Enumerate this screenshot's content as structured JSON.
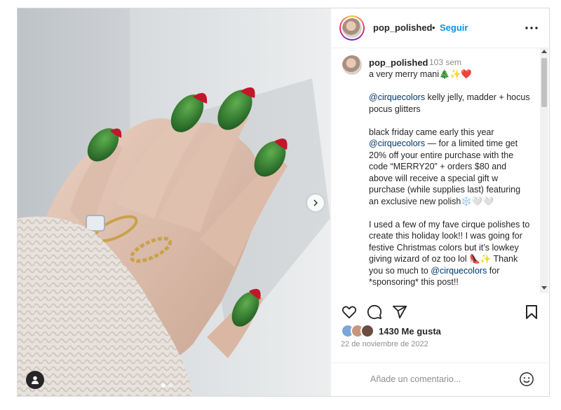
{
  "header": {
    "username": "pop_polished",
    "separator": "•",
    "follow_label": "Seguir"
  },
  "caption": {
    "username": "pop_polished",
    "time": "103 sem",
    "line1": "a very merry mani🎄✨❤️",
    "mention1": "@cirquecolors",
    "p2_rest": " kelly jelly, madder + hocus pocus glitters",
    "p3_start": "black friday came early this year ",
    "mention2": "@cirquecolors",
    "p3_rest": " — for a limited time get 20% off your entire purchase with the code “MERRY20” + orders $80 and above will receive a special gift w purchase (while supplies last) featuring an exclusive new polish❄️🤍🤍",
    "p4_start": "I used a few of my fave cirque polishes to create this holiday look!! I was going for festive Christmas colors but it’s lowkey giving wizard of oz too lol 👠✨ Thank you so much to ",
    "mention3": "@cirquecolors",
    "p4_rest": " for *sponsoring* this post!!"
  },
  "likes": {
    "count_label": "1430 Me gusta"
  },
  "date": "22 de noviembre de 2022",
  "comment": {
    "placeholder": "Añade un comentario..."
  },
  "carousel": {
    "current": 1,
    "total": 2
  },
  "icons": {
    "more": "more-options-icon",
    "like": "heart-icon",
    "comment": "comment-icon",
    "share": "share-icon",
    "save": "bookmark-icon",
    "next": "chevron-right-icon",
    "tag": "user-tag-icon",
    "emoji": "emoji-icon"
  },
  "colors": {
    "accent": "#0095f6",
    "nail_green": "#2e7d32",
    "glitter_red": "#c2162a"
  }
}
